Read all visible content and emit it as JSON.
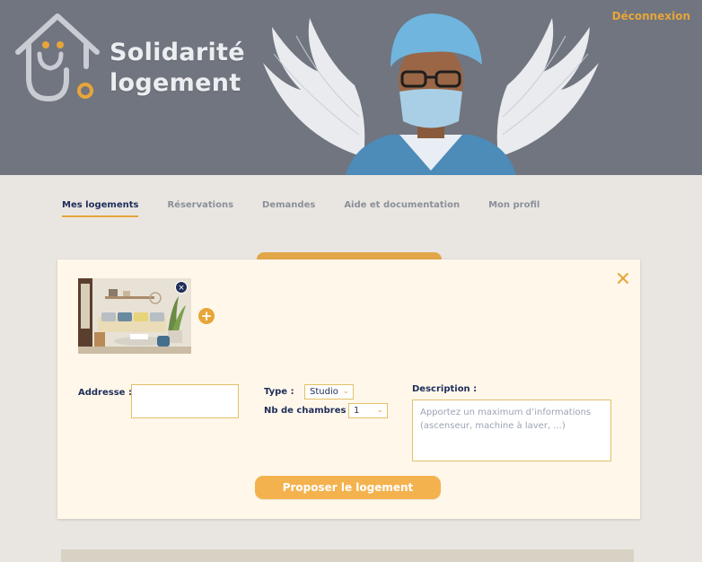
{
  "header": {
    "brand_line1": "Solidarité",
    "brand_line2": "logement",
    "logout_label": "Déconnexion"
  },
  "nav": {
    "tabs": [
      {
        "label": "Mes logements",
        "active": true
      },
      {
        "label": "Réservations",
        "active": false
      },
      {
        "label": "Demandes",
        "active": false
      },
      {
        "label": "Aide et documentation",
        "active": false
      },
      {
        "label": "Mon profil",
        "active": false
      }
    ]
  },
  "modal": {
    "close_icon": "close-icon",
    "remove_photo_symbol": "×",
    "add_photo_symbol": "+",
    "address_label": "Addresse :",
    "address_value": "",
    "type_label": "Type :",
    "type_value": "Studio",
    "rooms_label": "Nb de chambres :",
    "rooms_value": "1",
    "description_label": "Description :",
    "description_placeholder": "Apportez un maximum d’informations (ascenseur, machine à laver, ...)",
    "submit_label": "Proposer le logement"
  },
  "colors": {
    "accent": "#e7a53a",
    "navy": "#1f2d5a",
    "header_bg": "#70757f",
    "modal_bg": "#fff8ea"
  }
}
